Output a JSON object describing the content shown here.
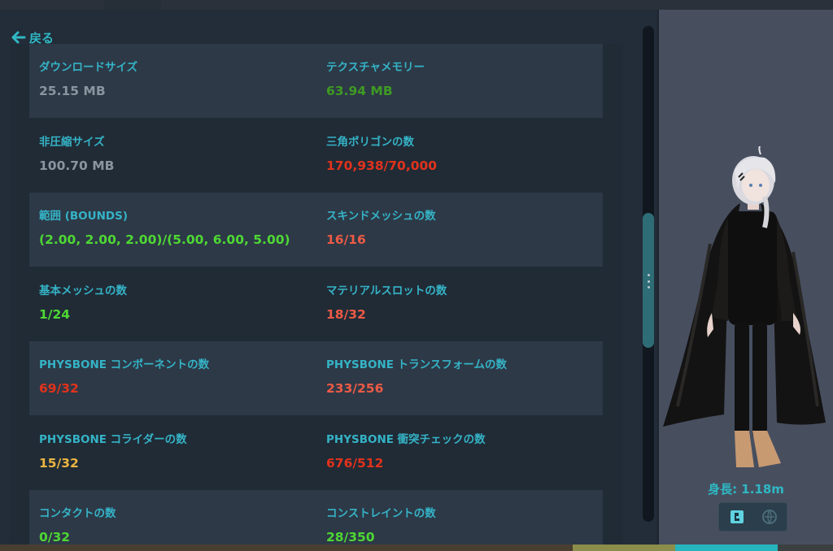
{
  "nav": {
    "back_label": "戻る"
  },
  "colors": {
    "accent": "#2fb8c4",
    "label": "#35b3c6",
    "neutral": "#8b95a0",
    "good": "#4ed834",
    "medium": "#3f9a23",
    "warn": "#ecb541",
    "poor": "#ec5a45",
    "very_poor": "#e1321c"
  },
  "stats": [
    {
      "label": "ダウンロードサイズ",
      "value": "25.15 MB",
      "status": "neutral"
    },
    {
      "label": "テクスチャメモリー",
      "value": "63.94 MB",
      "status": "medium"
    },
    {
      "label": "非圧縮サイズ",
      "value": "100.70 MB",
      "status": "neutral"
    },
    {
      "label": "三角ポリゴンの数",
      "value": "170,938/70,000",
      "status": "very_poor"
    },
    {
      "label": "範囲 (BOUNDS)",
      "value": "(2.00, 2.00, 2.00)/(5.00, 6.00, 5.00)",
      "status": "good"
    },
    {
      "label": "スキンドメッシュの数",
      "value": "16/16",
      "status": "poor"
    },
    {
      "label": "基本メッシュの数",
      "value": "1/24",
      "status": "good"
    },
    {
      "label": "マテリアルスロットの数",
      "value": "18/32",
      "status": "poor"
    },
    {
      "label": "PHYSBONE コンポーネントの数",
      "value": "69/32",
      "status": "very_poor"
    },
    {
      "label": "PHYSBONE トランスフォームの数",
      "value": "233/256",
      "status": "poor"
    },
    {
      "label": "PHYSBONE コライダーの数",
      "value": "15/32",
      "status": "warn"
    },
    {
      "label": "PHYSBONE 衝突チェックの数",
      "value": "676/512",
      "status": "very_poor"
    },
    {
      "label": "コンタクトの数",
      "value": "0/32",
      "status": "good"
    },
    {
      "label": "コンストレイントの数",
      "value": "28/350",
      "status": "good"
    }
  ],
  "preview": {
    "height_label": "身長: 1.18m",
    "view_options": [
      "avatar-view-icon",
      "world-view-icon"
    ]
  }
}
